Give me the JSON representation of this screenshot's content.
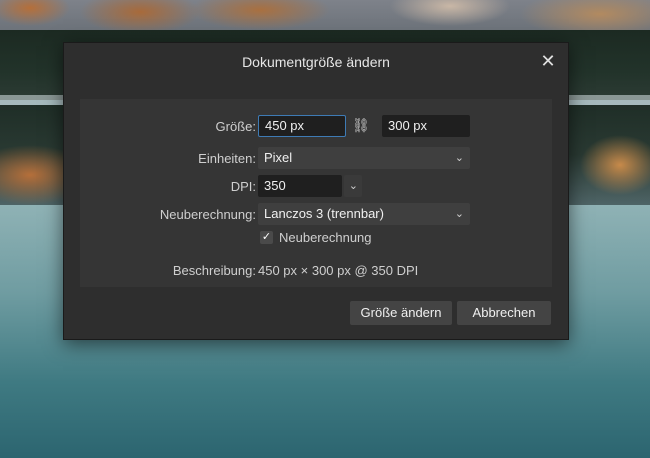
{
  "dialog": {
    "title": "Dokumentgröße ändern",
    "close_icon": "close-icon",
    "size": {
      "label": "Größe:",
      "width_value": "450 px",
      "height_value": "300 px",
      "link_icon": "chain-link-icon"
    },
    "units": {
      "label": "Einheiten:",
      "value": "Pixel"
    },
    "dpi": {
      "label": "DPI:",
      "value": "350"
    },
    "resample": {
      "label": "Neuberechnung:",
      "value": "Lanczos 3 (trennbar)"
    },
    "resample_checkbox": {
      "label": "Neuberechnung",
      "checked": true
    },
    "description": {
      "label": "Beschreibung:",
      "value": "450 px × 300 px @ 350 DPI"
    },
    "buttons": {
      "resize": "Größe ändern",
      "cancel": "Abbrechen"
    }
  },
  "colors": {
    "dialog_bg": "#2e2e2e",
    "panel_bg": "#353535",
    "focus_border": "#3e7bb5"
  }
}
